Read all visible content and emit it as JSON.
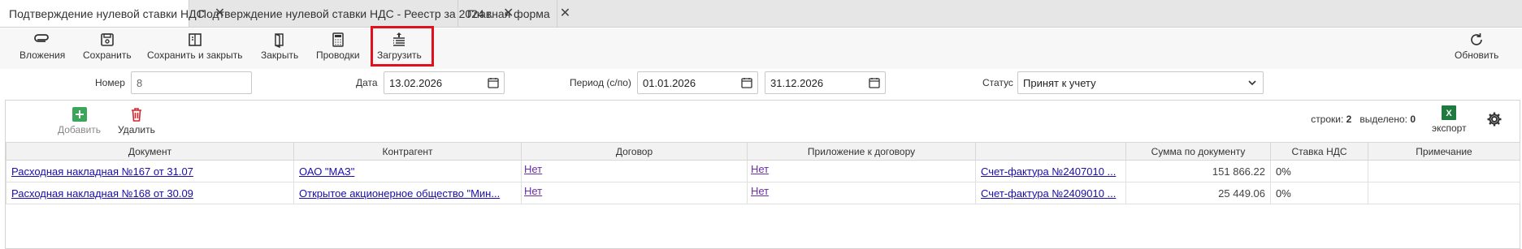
{
  "tabs": [
    {
      "label": "Подтверждение нулевой ставки НДС",
      "active": true
    },
    {
      "label": "Подтверждение нулевой ставки НДС - Реестр за 2024 г.",
      "active": false
    },
    {
      "label": "Главная форма",
      "active": false
    }
  ],
  "toolbar": {
    "attachments": "Вложения",
    "save": "Сохранить",
    "save_close": "Сохранить и закрыть",
    "close": "Закрыть",
    "postings": "Проводки",
    "load": "Загрузить",
    "refresh": "Обновить"
  },
  "filters": {
    "number_label": "Номер",
    "number_value": "8",
    "date_label": "Дата",
    "date_value": "13.02.2026",
    "period_label": "Период (с/по)",
    "period_from": "01.01.2026",
    "period_to": "31.12.2026",
    "status_label": "Статус",
    "status_value": "Принят к учету"
  },
  "grid_toolbar": {
    "add": "Добавить",
    "delete": "Удалить",
    "rows_label": "строки:",
    "rows_count": "2",
    "selected_label": "выделено:",
    "selected_count": "0",
    "export": "экспорт"
  },
  "columns": [
    "Документ",
    "Контрагент",
    "Договор",
    "Приложение к договору",
    "",
    "Сумма по документу",
    "Ставка НДС",
    "Примечание"
  ],
  "rows": [
    {
      "doc": "Расходная накладная №167 от 31.07",
      "counterparty": "ОАО \"МАЗ\"",
      "contract": "Нет",
      "appendix": "Нет",
      "invoice": "Счет-фактура №2407010 ...",
      "sum": "151 866.22",
      "vat": "0%",
      "note": ""
    },
    {
      "doc": "Расходная накладная №168 от 30.09",
      "counterparty": "Открытое акционерное общество \"Мин...",
      "contract": "Нет",
      "appendix": "Нет",
      "invoice": "Счет-фактура №2409010 ...",
      "sum": "25 449.06",
      "vat": "0%",
      "note": ""
    }
  ],
  "colors": {
    "highlight": "#e0101c",
    "link": "#1a0dab",
    "add_green": "#3aa65a",
    "delete_red": "#d9252b",
    "export_green": "#1e7a3e"
  }
}
